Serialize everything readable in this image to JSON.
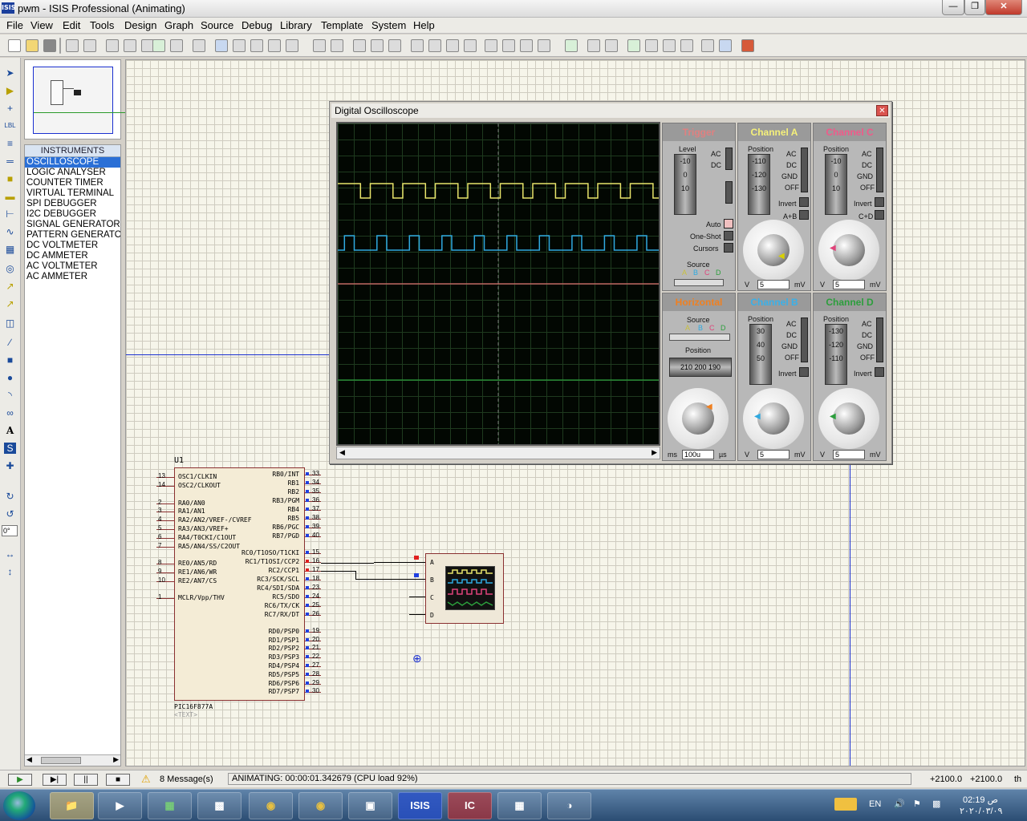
{
  "window": {
    "title": "pwm - ISIS Professional (Animating)",
    "app_badge": "ISIS"
  },
  "menu": [
    "File",
    "View",
    "Edit",
    "Tools",
    "Design",
    "Graph",
    "Source",
    "Debug",
    "Library",
    "Template",
    "System",
    "Help"
  ],
  "device_panel": {
    "header": "INSTRUMENTS",
    "items": [
      "OSCILLOSCOPE",
      "LOGIC ANALYSER",
      "COUNTER TIMER",
      "VIRTUAL TERMINAL",
      "SPI DEBUGGER",
      "I2C DEBUGGER",
      "SIGNAL GENERATOR",
      "PATTERN GENERATOR",
      "DC VOLTMETER",
      "DC AMMETER",
      "AC VOLTMETER",
      "AC AMMETER"
    ],
    "selected": "OSCILLOSCOPE"
  },
  "rotation_field": "0°",
  "oscilloscope": {
    "title": "Digital Oscilloscope",
    "trigger": {
      "title": "Trigger",
      "level_label": "Level",
      "level_scale": [
        "-10",
        "0",
        "10"
      ],
      "ac": "AC",
      "dc": "DC",
      "auto": "Auto",
      "oneshot": "One-Shot",
      "cursors": "Cursors",
      "source": "Source",
      "source_letters": [
        "A",
        "B",
        "C",
        "D"
      ]
    },
    "channel_a": {
      "title": "Channel A",
      "position_label": "Position",
      "scale": [
        "-110",
        "-120",
        "-130"
      ],
      "coupling": [
        "AC",
        "DC",
        "GND",
        "OFF"
      ],
      "invert": "Invert",
      "combine": "A+B",
      "value": "5",
      "unit_left": "V",
      "unit_right": "mV"
    },
    "channel_c": {
      "title": "Channel C",
      "position_label": "Position",
      "scale": [
        "-10",
        "0",
        "10"
      ],
      "coupling": [
        "AC",
        "DC",
        "GND",
        "OFF"
      ],
      "invert": "Invert",
      "combine": "C+D",
      "value": "5",
      "unit_left": "V",
      "unit_right": "mV"
    },
    "horizontal": {
      "title": "Horizontal",
      "source": "Source",
      "source_letters": [
        "A",
        "B",
        "C",
        "D"
      ],
      "position_label": "Position",
      "position_scale": "210 200 190",
      "value": "100u",
      "unit_left": "ms",
      "unit_right": "µs"
    },
    "channel_b": {
      "title": "Channel B",
      "position_label": "Position",
      "scale": [
        "30",
        "40",
        "50"
      ],
      "coupling": [
        "AC",
        "DC",
        "GND",
        "OFF"
      ],
      "invert": "Invert",
      "value": "5",
      "unit_left": "V",
      "unit_right": "mV"
    },
    "channel_d": {
      "title": "Channel D",
      "position_label": "Position",
      "scale": [
        "-130",
        "-120",
        "-110"
      ],
      "coupling": [
        "AC",
        "DC",
        "GND",
        "OFF"
      ],
      "invert": "Invert",
      "value": "5",
      "unit_left": "V",
      "unit_right": "mV"
    },
    "knob_marks": {
      "volts": [
        "0.5",
        "0.2",
        "0.1",
        "50",
        "20",
        "10",
        "5",
        "2",
        "1",
        "20",
        "10",
        "5",
        "2",
        "1"
      ],
      "time": [
        "0.5",
        "0.2",
        "0.1",
        "50",
        "20",
        "10",
        "5",
        "2",
        "1",
        "0.5",
        "200",
        "100",
        "50",
        "20",
        "10",
        "5",
        "2",
        "1",
        "0.5",
        "0.2"
      ]
    },
    "colors": {
      "a": "#e8e46a",
      "b": "#2fa9e0",
      "c": "#e0437a",
      "d": "#2c9e3c",
      "trigger": "#e08080",
      "horizontal": "#f08020"
    }
  },
  "schematic": {
    "ref": "U1",
    "part": "PIC16F877A",
    "text_placeholder": "<TEXT>",
    "left_pins": [
      {
        "num": "13",
        "name": "OSC1/CLKIN"
      },
      {
        "num": "14",
        "name": "OSC2/CLKOUT"
      },
      {
        "num": "2",
        "name": "RA0/AN0"
      },
      {
        "num": "3",
        "name": "RA1/AN1"
      },
      {
        "num": "4",
        "name": "RA2/AN2/VREF-/CVREF"
      },
      {
        "num": "5",
        "name": "RA3/AN3/VREF+"
      },
      {
        "num": "6",
        "name": "RA4/T0CKI/C1OUT"
      },
      {
        "num": "7",
        "name": "RA5/AN4/SS/C2OUT"
      },
      {
        "num": "8",
        "name": "RE0/AN5/RD"
      },
      {
        "num": "9",
        "name": "RE1/AN6/WR"
      },
      {
        "num": "10",
        "name": "RE2/AN7/CS"
      },
      {
        "num": "1",
        "name": "MCLR/Vpp/THV"
      }
    ],
    "right_pins": [
      {
        "num": "33",
        "name": "RB0/INT"
      },
      {
        "num": "34",
        "name": "RB1"
      },
      {
        "num": "35",
        "name": "RB2"
      },
      {
        "num": "36",
        "name": "RB3/PGM"
      },
      {
        "num": "37",
        "name": "RB4"
      },
      {
        "num": "38",
        "name": "RB5"
      },
      {
        "num": "39",
        "name": "RB6/PGC"
      },
      {
        "num": "40",
        "name": "RB7/PGD"
      },
      {
        "num": "15",
        "name": "RC0/T1OSO/T1CKI"
      },
      {
        "num": "16",
        "name": "RC1/T1OSI/CCP2"
      },
      {
        "num": "17",
        "name": "RC2/CCP1"
      },
      {
        "num": "18",
        "name": "RC3/SCK/SCL"
      },
      {
        "num": "23",
        "name": "RC4/SDI/SDA"
      },
      {
        "num": "24",
        "name": "RC5/SDO"
      },
      {
        "num": "25",
        "name": "RC6/TX/CK"
      },
      {
        "num": "26",
        "name": "RC7/RX/DT"
      },
      {
        "num": "19",
        "name": "RD0/PSP0"
      },
      {
        "num": "20",
        "name": "RD1/PSP1"
      },
      {
        "num": "21",
        "name": "RD2/PSP2"
      },
      {
        "num": "22",
        "name": "RD3/PSP3"
      },
      {
        "num": "27",
        "name": "RD4/PSP4"
      },
      {
        "num": "28",
        "name": "RD5/PSP5"
      },
      {
        "num": "29",
        "name": "RD6/PSP6"
      },
      {
        "num": "30",
        "name": "RD7/PSP7"
      }
    ],
    "scope_inputs": [
      "A",
      "B",
      "C",
      "D"
    ]
  },
  "status": {
    "messages": "8 Message(s)",
    "animating": "ANIMATING: 00:00:01.342679 (CPU load 92%)",
    "coord_x": "+2100.0",
    "coord_y": "+2100.0",
    "units": "th"
  },
  "taskbar": {
    "lang": "EN",
    "time": "02:19 ص",
    "date": "۲۰۲۰/۰۳/۰۹",
    "isis_label": "ISIS"
  }
}
